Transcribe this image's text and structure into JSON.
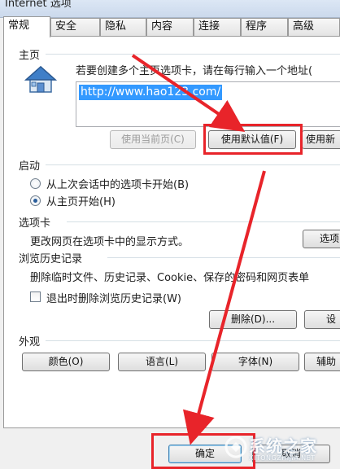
{
  "window": {
    "title": "Internet 选项"
  },
  "tabs": [
    {
      "label": "常规",
      "active": true
    },
    {
      "label": "安全"
    },
    {
      "label": "隐私"
    },
    {
      "label": "内容"
    },
    {
      "label": "连接"
    },
    {
      "label": "程序"
    },
    {
      "label": "高级"
    }
  ],
  "homepage": {
    "section_label": "主页",
    "description": "若要创建多个主页选项卡，请在每行输入一个地址(",
    "url": "http://www.hao123.com/",
    "use_current_label": "使用当前页(C)",
    "use_default_label": "使用默认值(F)",
    "use_new_label": "使用新"
  },
  "startup": {
    "section_label": "启动",
    "option_last_session": "从上次会话中的选项卡开始(B)",
    "option_homepage": "从主页开始(H)",
    "selected": "option_homepage"
  },
  "tabs_section": {
    "section_label": "选项卡",
    "description": "更改网页在选项卡中的显示方式。",
    "button_label": "选项"
  },
  "history": {
    "section_label": "浏览历史记录",
    "description": "删除临时文件、历史记录、Cookie、保存的密码和网页表单",
    "checkbox_label": "退出时删除浏览历史记录(W)",
    "checkbox_checked": false,
    "delete_label": "删除(D)...",
    "settings_label": "设"
  },
  "appearance": {
    "section_label": "外观",
    "colors_label": "颜色(O)",
    "languages_label": "语言(L)",
    "fonts_label": "字体(N)",
    "accessibility_label": "辅助"
  },
  "footer": {
    "ok_label": "确定",
    "cancel_label": "取消"
  },
  "watermark": {
    "text": "系统之家",
    "sub": "XITONGZHIJIA.NET"
  },
  "colors": {
    "annotation_red": "#e8242a",
    "selection_blue": "#3399ff"
  }
}
